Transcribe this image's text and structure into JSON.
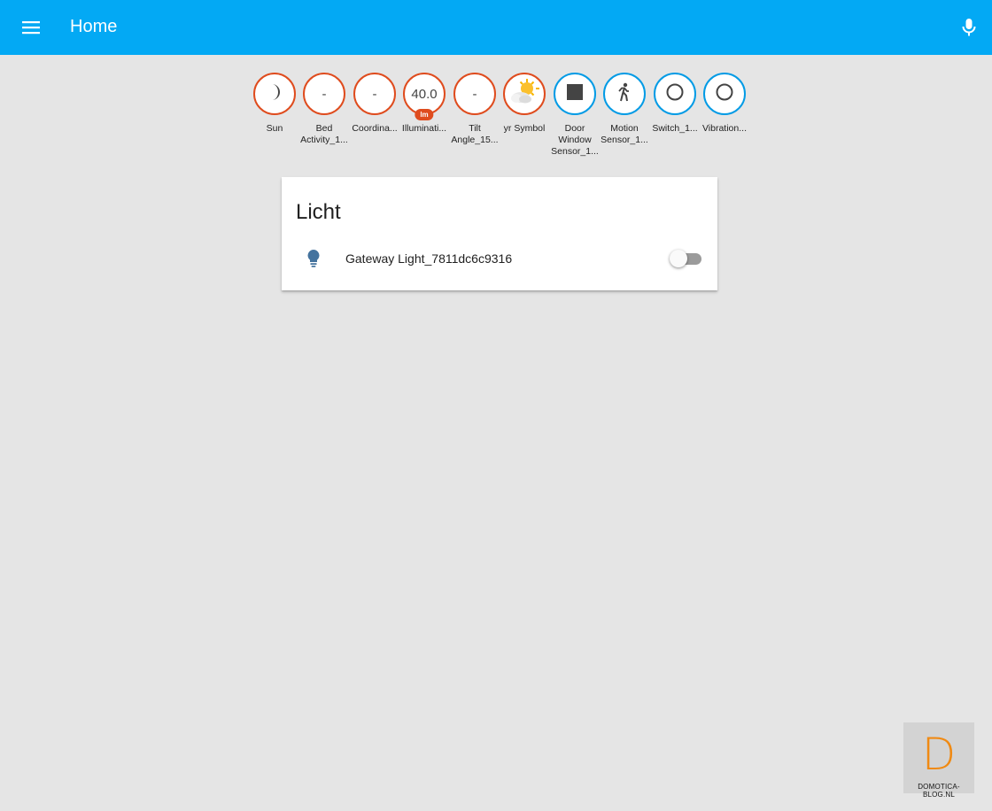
{
  "app": {
    "title": "Home"
  },
  "colors": {
    "header": "#03a9f4",
    "badge_orange": "#df4c1e",
    "badge_blue": "#039be5",
    "bulb": "#44739e",
    "watermark_letter": "#f08a13"
  },
  "badges": [
    {
      "label": "Sun",
      "value": "",
      "unit": "",
      "icon": "moon-icon",
      "color": "orange"
    },
    {
      "label": "Bed Activity_1...",
      "value": "-",
      "unit": "",
      "icon": "",
      "color": "orange"
    },
    {
      "label": "Coordina...",
      "value": "-",
      "unit": "",
      "icon": "",
      "color": "orange"
    },
    {
      "label": "Illuminati...",
      "value": "40.0",
      "unit": "lm",
      "icon": "",
      "color": "orange"
    },
    {
      "label": "Tilt Angle_15...",
      "value": "-",
      "unit": "",
      "icon": "",
      "color": "orange"
    },
    {
      "label": "yr Symbol",
      "value": "",
      "unit": "",
      "icon": "weather-partly-cloudy-icon",
      "color": "orange"
    },
    {
      "label": "Door Window Sensor_1...",
      "value": "",
      "unit": "",
      "icon": "square-icon",
      "color": "blue"
    },
    {
      "label": "Motion Sensor_1...",
      "value": "",
      "unit": "",
      "icon": "walking-person-icon",
      "color": "blue"
    },
    {
      "label": "Switch_1...",
      "value": "",
      "unit": "",
      "icon": "circle-outline-icon",
      "color": "blue"
    },
    {
      "label": "Vibration...",
      "value": "",
      "unit": "",
      "icon": "circle-outline-icon",
      "color": "blue"
    }
  ],
  "card": {
    "title": "Licht",
    "entities": [
      {
        "name": "Gateway Light_7811dc6c9316",
        "icon": "lightbulb-icon",
        "state": "off"
      }
    ]
  },
  "watermark": {
    "letter": "D",
    "text": "DOMOTICA-BLOG.NL"
  }
}
